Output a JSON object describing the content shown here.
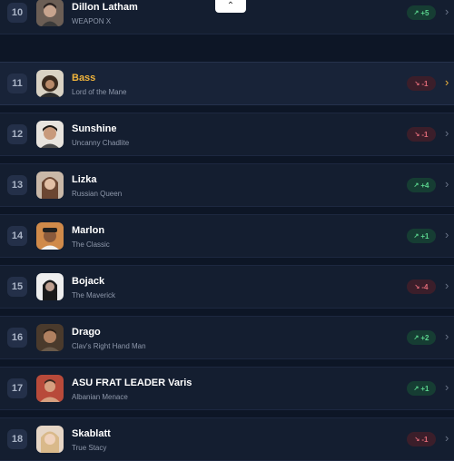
{
  "rows": [
    {
      "rank": "10",
      "name": "Dillon Latham",
      "title": "WEAPON X",
      "change": "+5",
      "trend": "up"
    },
    {
      "rank": "11",
      "name": "Bass",
      "title": "Lord of the Mane",
      "change": "-1",
      "trend": "down"
    },
    {
      "rank": "12",
      "name": "Sunshine",
      "title": "Uncanny Chadlite",
      "change": "-1",
      "trend": "down"
    },
    {
      "rank": "13",
      "name": "Lizka",
      "title": "Russian Queen",
      "change": "+4",
      "trend": "up"
    },
    {
      "rank": "14",
      "name": "Marlon",
      "title": "The Classic",
      "change": "+1",
      "trend": "up"
    },
    {
      "rank": "15",
      "name": "Bojack",
      "title": "The Maverick",
      "change": "-4",
      "trend": "down"
    },
    {
      "rank": "16",
      "name": "Drago",
      "title": "Clav's Right Hand Man",
      "change": "+2",
      "trend": "up"
    },
    {
      "rank": "17",
      "name": "ASU FRAT LEADER Varis",
      "title": "Albanian Menace",
      "change": "+1",
      "trend": "up"
    },
    {
      "rank": "18",
      "name": "Skablatt",
      "title": "True Stacy",
      "change": "-1",
      "trend": "down"
    }
  ],
  "icons": {
    "collapse": "chevron-up-icon",
    "trend_up": "trending-up-icon",
    "trend_down": "trending-down-icon",
    "row_open": "chevron-right-icon"
  },
  "colors": {
    "background": "#0d1626",
    "row": "#141e30",
    "highlight_name": "#f0b43c",
    "up_text": "#5bd48e",
    "down_text": "#e06a78"
  }
}
